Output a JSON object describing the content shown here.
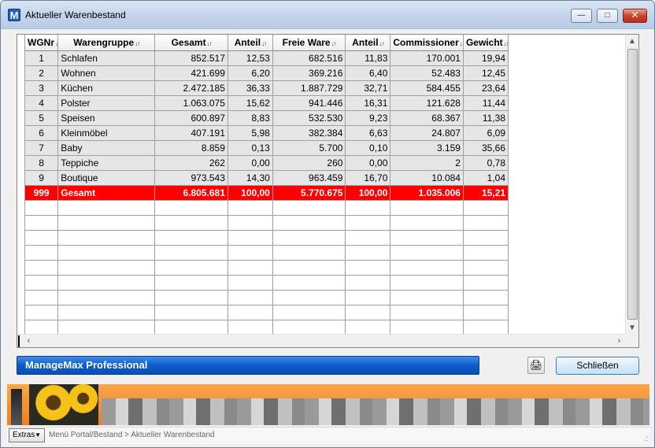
{
  "window": {
    "title": "Aktueller Warenbestand",
    "app_icon_letter": "M"
  },
  "titlebar_buttons": {
    "minimize": "—",
    "maximize": "□",
    "close": "✕"
  },
  "table": {
    "columns": [
      "WGNr",
      "Warengruppe",
      "Gesamt",
      "Anteil",
      "Freie Ware",
      "Anteil",
      "Commissioner",
      "Gewicht"
    ],
    "rows": [
      [
        "1",
        "Schlafen",
        "852.517",
        "12,53",
        "682.516",
        "11,83",
        "170.001",
        "19,94"
      ],
      [
        "2",
        "Wohnen",
        "421.699",
        "6,20",
        "369.216",
        "6,40",
        "52.483",
        "12,45"
      ],
      [
        "3",
        "Küchen",
        "2.472.185",
        "36,33",
        "1.887.729",
        "32,71",
        "584.455",
        "23,64"
      ],
      [
        "4",
        "Polster",
        "1.063.075",
        "15,62",
        "941.446",
        "16,31",
        "121.628",
        "11,44"
      ],
      [
        "5",
        "Speisen",
        "600.897",
        "8,83",
        "532.530",
        "9,23",
        "68.367",
        "11,38"
      ],
      [
        "6",
        "Kleinmöbel",
        "407.191",
        "5,98",
        "382.384",
        "6,63",
        "24.807",
        "6,09"
      ],
      [
        "7",
        "Baby",
        "8.859",
        "0,13",
        "5.700",
        "0,10",
        "3.159",
        "35,66"
      ],
      [
        "8",
        "Teppiche",
        "262",
        "0,00",
        "260",
        "0,00",
        "2",
        "0,78"
      ],
      [
        "9",
        "Boutique",
        "973.543",
        "14,30",
        "963.459",
        "16,70",
        "10.084",
        "1,04"
      ]
    ],
    "total": [
      "999",
      "Gesamt",
      "6.805.681",
      "100,00",
      "5.770.675",
      "100,00",
      "1.035.006",
      "15,21"
    ],
    "empty_rows": 9
  },
  "footer": {
    "brand": "ManageMax Professional",
    "print_icon": "🖨",
    "close_label": "Schließen"
  },
  "statusbar": {
    "extras_label": "Extras",
    "breadcrumb": "Menü Portal/Bestand > Aktueller Warenbestand"
  },
  "colors": {
    "total_row": "#ff0000",
    "brand_bar": "#0b5ccc",
    "banner": "#f07e1f"
  }
}
